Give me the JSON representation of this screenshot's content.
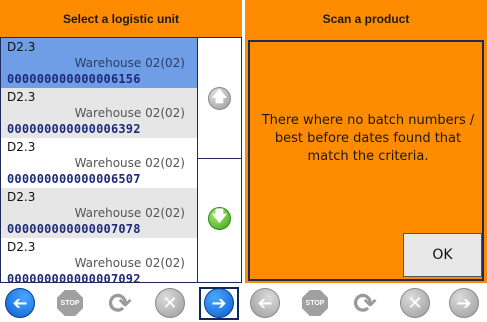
{
  "left_panel": {
    "title": "Select a logistic unit",
    "rows": [
      {
        "code": "D2.3",
        "warehouse": "Warehouse 02(02)",
        "number": "000000000000006156",
        "selected": true
      },
      {
        "code": "D2.3",
        "warehouse": "Warehouse 02(02)",
        "number": "000000000000006392",
        "selected": false
      },
      {
        "code": "D2.3",
        "warehouse": "Warehouse 02(02)",
        "number": "000000000000006507",
        "selected": false
      },
      {
        "code": "D2.3",
        "warehouse": "Warehouse 02(02)",
        "number": "000000000000007078",
        "selected": false
      },
      {
        "code": "D2.3",
        "warehouse": "Warehouse 02(02)",
        "number": "000000000000007092",
        "selected": false
      }
    ],
    "toolbar": {
      "stop_label": "STOP"
    }
  },
  "right_panel": {
    "title": "Scan a product",
    "message": "There where no batch numbers / best before dates found that match the criteria.",
    "ok_label": "OK",
    "toolbar": {
      "stop_label": "STOP"
    }
  },
  "colors": {
    "accent": "#ff8c00",
    "selection": "#6f9ee6",
    "number_text": "#1e2a7a"
  },
  "icons": [
    "back-arrow-icon",
    "stop-icon",
    "refresh-icon",
    "cancel-icon",
    "forward-arrow-icon",
    "scroll-up-icon",
    "scroll-down-icon"
  ]
}
